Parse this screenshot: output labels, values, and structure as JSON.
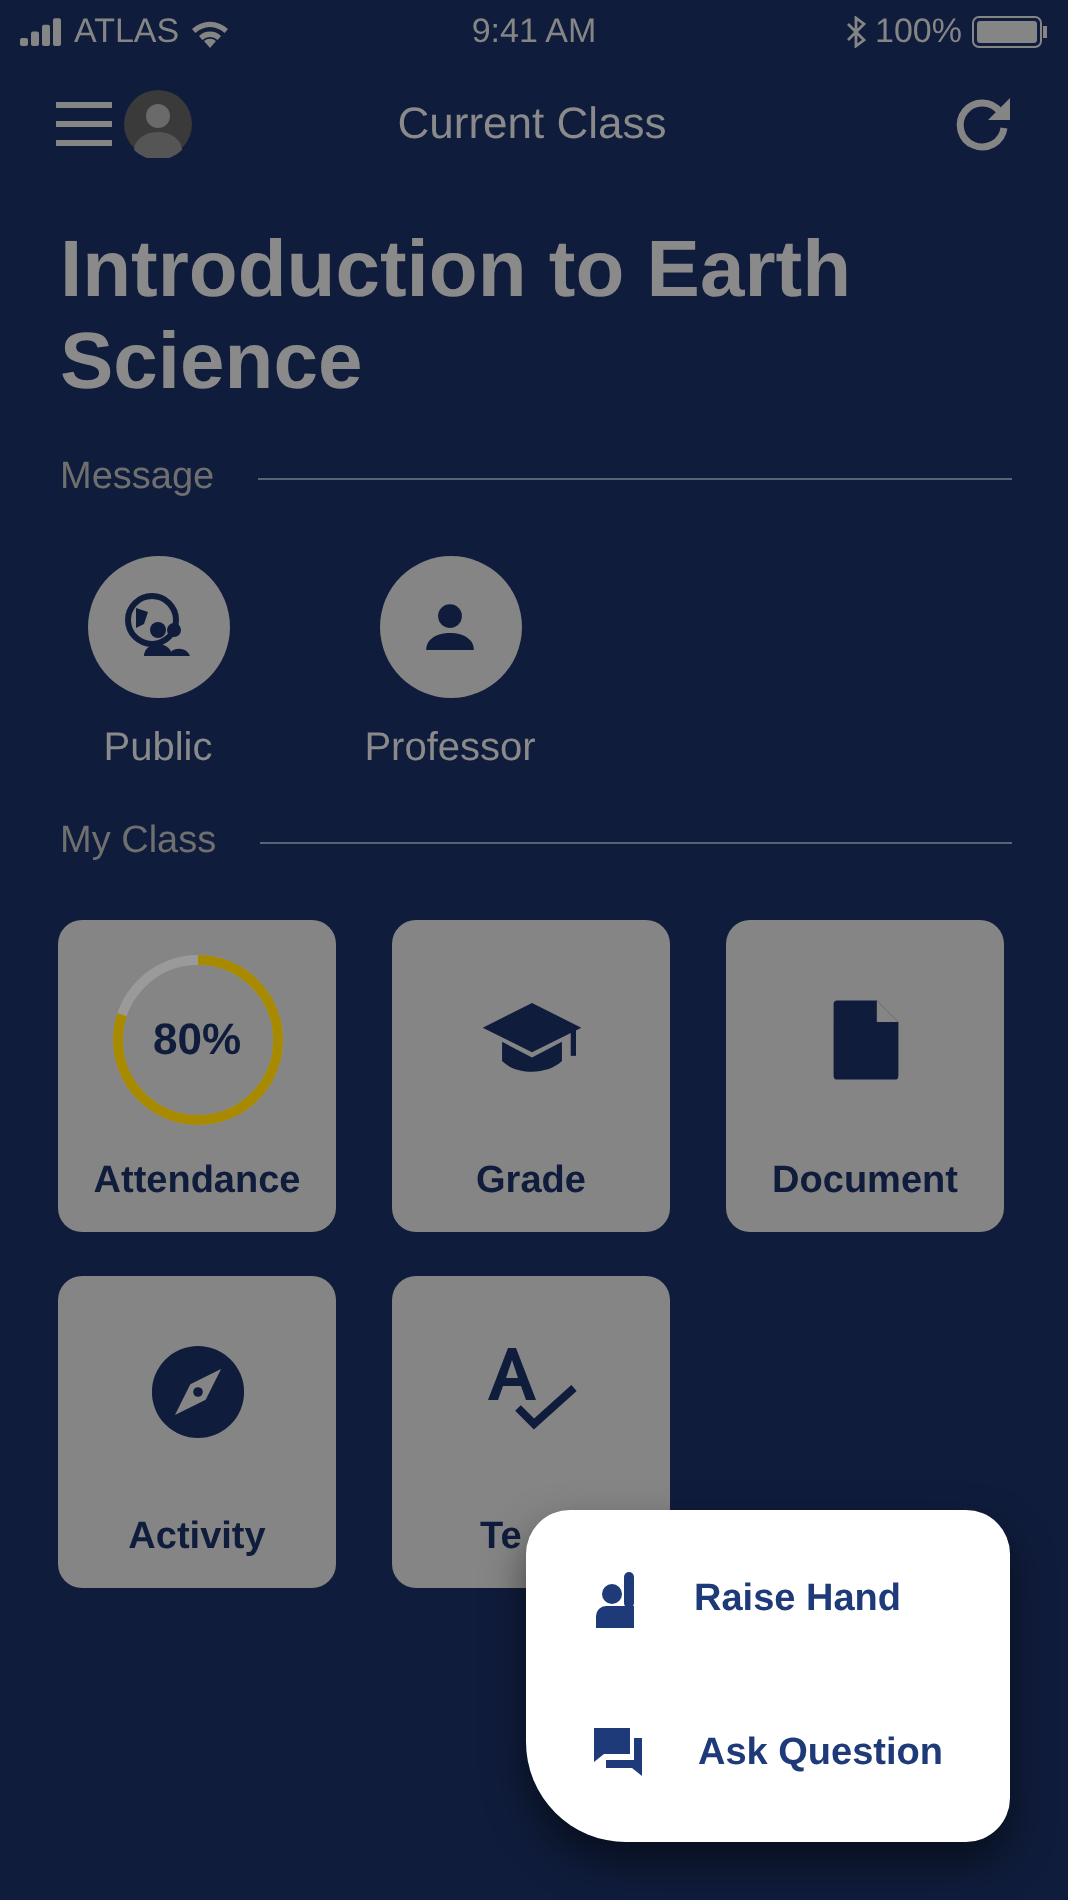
{
  "status_bar": {
    "carrier": "ATLAS",
    "time": "9:41 AM",
    "battery": "100%"
  },
  "header": {
    "title": "Current Class"
  },
  "course_title": "Introduction to Earth Science",
  "message_section": {
    "label": "Message",
    "contacts": [
      {
        "label": "Public"
      },
      {
        "label": "Professor"
      }
    ]
  },
  "class_section": {
    "label": "My Class",
    "tiles": [
      {
        "kind": "progress",
        "label": "Attendance",
        "value": "80%"
      },
      {
        "kind": "icon",
        "label": "Grade"
      },
      {
        "kind": "icon",
        "label": "Document"
      },
      {
        "kind": "icon",
        "label": "Activity"
      },
      {
        "kind": "icon",
        "label": "Te"
      }
    ]
  },
  "popup_menu": {
    "items": [
      {
        "label": "Raise Hand"
      },
      {
        "label": "Ask Question"
      }
    ]
  }
}
